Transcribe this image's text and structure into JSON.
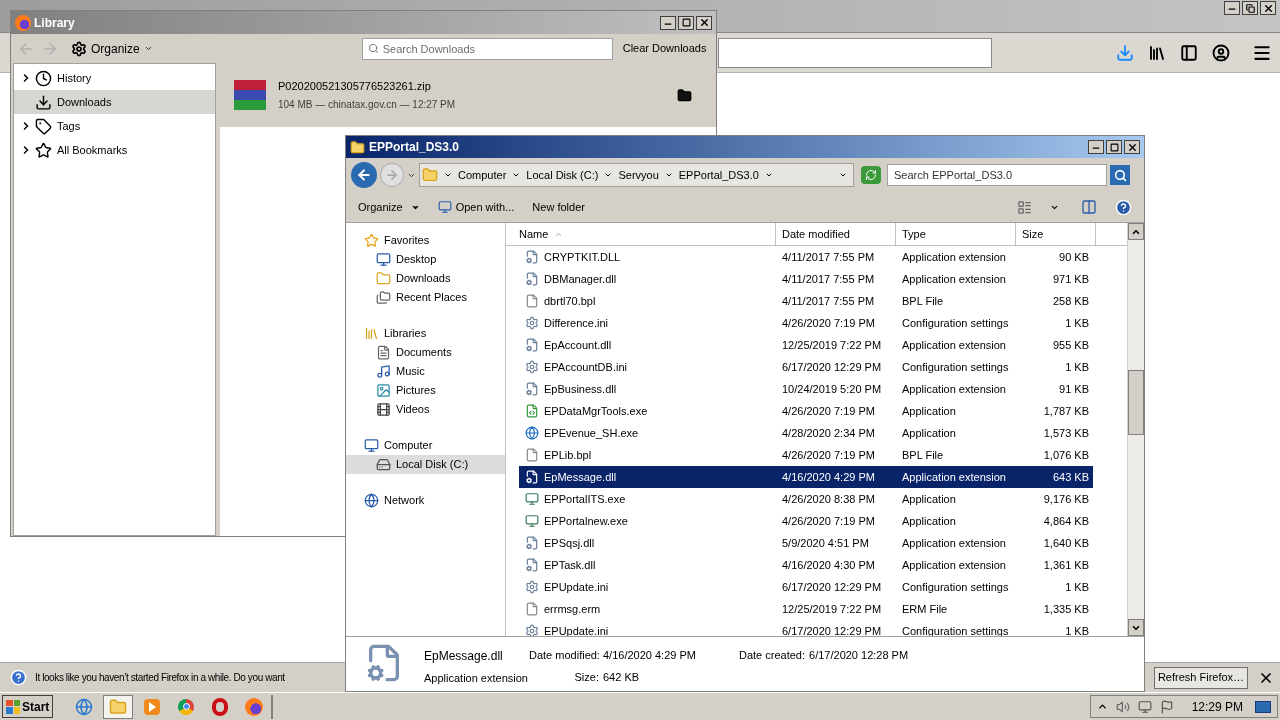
{
  "firefox": {
    "notification": {
      "message": "It looks like you haven’t started Firefox in a while. Do you want",
      "button": "Refresh Firefox…"
    }
  },
  "library": {
    "title": "Library",
    "organize": "Organize",
    "search_placeholder": "Search Downloads",
    "clear_button": "Clear Downloads",
    "sidebar": [
      {
        "label": "History",
        "kind": "clock",
        "expandable": true,
        "selected": false
      },
      {
        "label": "Downloads",
        "kind": "download",
        "expandable": false,
        "selected": true
      },
      {
        "label": "Tags",
        "kind": "tag",
        "expandable": true,
        "selected": false
      },
      {
        "label": "All Bookmarks",
        "kind": "star",
        "expandable": true,
        "selected": false
      }
    ],
    "downloads": [
      {
        "filename": "P020200521305776523261.zip",
        "details": "104 MB — chinatax.gov.cn — 12:27 PM",
        "selected": true
      }
    ]
  },
  "explorer": {
    "title": "EPPortal_DS3.0",
    "breadcrumb": [
      "Computer",
      "Local Disk (C:)",
      "Servyou",
      "EPPortal_DS3.0"
    ],
    "search_placeholder": "Search EPPortal_DS3.0",
    "toolbar": {
      "organize": "Organize",
      "open_with": "Open with...",
      "new_folder": "New folder"
    },
    "nav": [
      {
        "label": "Favorites",
        "kind": "star",
        "selected": false,
        "children": [
          {
            "label": "Desktop",
            "kind": "desktop",
            "selected": false
          },
          {
            "label": "Downloads",
            "kind": "folder",
            "selected": false
          },
          {
            "label": "Recent Places",
            "kind": "recent",
            "selected": false
          }
        ]
      },
      {
        "label": "Libraries",
        "kind": "library",
        "selected": false,
        "children": [
          {
            "label": "Documents",
            "kind": "documents",
            "selected": false
          },
          {
            "label": "Music",
            "kind": "music",
            "selected": false
          },
          {
            "label": "Pictures",
            "kind": "pictures",
            "selected": false
          },
          {
            "label": "Videos",
            "kind": "videos",
            "selected": false
          }
        ]
      },
      {
        "label": "Computer",
        "kind": "computer",
        "selected": false,
        "children": [
          {
            "label": "Local Disk (C:)",
            "kind": "disk",
            "selected": true
          }
        ]
      },
      {
        "label": "Network",
        "kind": "network",
        "selected": false
      }
    ],
    "columns": [
      {
        "label": "Name",
        "sorted": true
      },
      {
        "label": "Date modified",
        "sorted": false
      },
      {
        "label": "Type",
        "sorted": false
      },
      {
        "label": "Size",
        "sorted": false
      }
    ],
    "files": [
      {
        "name": "CRYPTKIT.DLL",
        "date": "4/11/2017 7:55 PM",
        "type": "Application extension",
        "size": "90 KB",
        "kind": "extension",
        "selected": false
      },
      {
        "name": "DBManager.dll",
        "date": "4/11/2017 7:55 PM",
        "type": "Application extension",
        "size": "971 KB",
        "kind": "extension",
        "selected": false
      },
      {
        "name": "dbrtl70.bpl",
        "date": "4/11/2017 7:55 PM",
        "type": "BPL File",
        "size": "258 KB",
        "kind": "file",
        "selected": false
      },
      {
        "name": "Difference.ini",
        "date": "4/26/2020 7:19 PM",
        "type": "Configuration settings",
        "size": "1 KB",
        "kind": "settings",
        "selected": false
      },
      {
        "name": "EpAccount.dll",
        "date": "12/25/2019 7:22 PM",
        "type": "Application extension",
        "size": "955 KB",
        "kind": "extension",
        "selected": false
      },
      {
        "name": "EPAccountDB.ini",
        "date": "6/17/2020 12:29 PM",
        "type": "Configuration settings",
        "size": "1 KB",
        "kind": "settings",
        "selected": false
      },
      {
        "name": "EpBusiness.dll",
        "date": "10/24/2019 5:20 PM",
        "type": "Application extension",
        "size": "91 KB",
        "kind": "extension",
        "selected": false
      },
      {
        "name": "EPDataMgrTools.exe",
        "date": "4/26/2020 7:19 PM",
        "type": "Application",
        "size": "1,787 KB",
        "kind": "app-green",
        "selected": false
      },
      {
        "name": "EPEvenue_SH.exe",
        "date": "4/28/2020 2:34 PM",
        "type": "Application",
        "size": "1,573 KB",
        "kind": "app-globe",
        "selected": false
      },
      {
        "name": "EPLib.bpl",
        "date": "4/26/2020 7:19 PM",
        "type": "BPL File",
        "size": "1,076 KB",
        "kind": "file",
        "selected": false
      },
      {
        "name": "EpMessage.dll",
        "date": "4/16/2020 4:29 PM",
        "type": "Application extension",
        "size": "643 KB",
        "kind": "extension",
        "selected": true
      },
      {
        "name": "EPPortalITS.exe",
        "date": "4/26/2020 8:38 PM",
        "type": "Application",
        "size": "9,176 KB",
        "kind": "app",
        "selected": false
      },
      {
        "name": "EPPortalnew.exe",
        "date": "4/26/2020 7:19 PM",
        "type": "Application",
        "size": "4,864 KB",
        "kind": "app",
        "selected": false
      },
      {
        "name": "EPSqsj.dll",
        "date": "5/9/2020 4:51 PM",
        "type": "Application extension",
        "size": "1,640 KB",
        "kind": "extension",
        "selected": false
      },
      {
        "name": "EPTask.dll",
        "date": "4/16/2020 4:30 PM",
        "type": "Application extension",
        "size": "1,361 KB",
        "kind": "extension",
        "selected": false
      },
      {
        "name": "EPUpdate.ini",
        "date": "6/17/2020 12:29 PM",
        "type": "Configuration settings",
        "size": "1 KB",
        "kind": "settings",
        "selected": false
      },
      {
        "name": "errmsg.erm",
        "date": "12/25/2019 7:22 PM",
        "type": "ERM File",
        "size": "1,335 KB",
        "kind": "file",
        "selected": false
      },
      {
        "name": "EPUpdate.ini",
        "date": "6/17/2020 12:29 PM",
        "type": "Configuration settings",
        "size": "1 KB",
        "kind": "settings",
        "selected": false
      }
    ],
    "details": {
      "name": "EpMessage.dll",
      "type": "Application extension",
      "fields": [
        {
          "label": "Date modified:",
          "value": "4/16/2020 4:29 PM"
        },
        {
          "label": "Size:",
          "value": "642 KB"
        },
        {
          "label": "Date created:",
          "value": "6/17/2020 12:28 PM"
        }
      ]
    }
  },
  "taskbar": {
    "start": "Start",
    "apps": [
      {
        "kind": "ie",
        "pressed": false
      },
      {
        "kind": "explorer",
        "pressed": true
      },
      {
        "kind": "media",
        "pressed": false
      },
      {
        "kind": "chrome",
        "pressed": false
      },
      {
        "kind": "opera",
        "pressed": false
      },
      {
        "kind": "firefox",
        "pressed": false
      }
    ],
    "clock": "12:29 PM"
  }
}
